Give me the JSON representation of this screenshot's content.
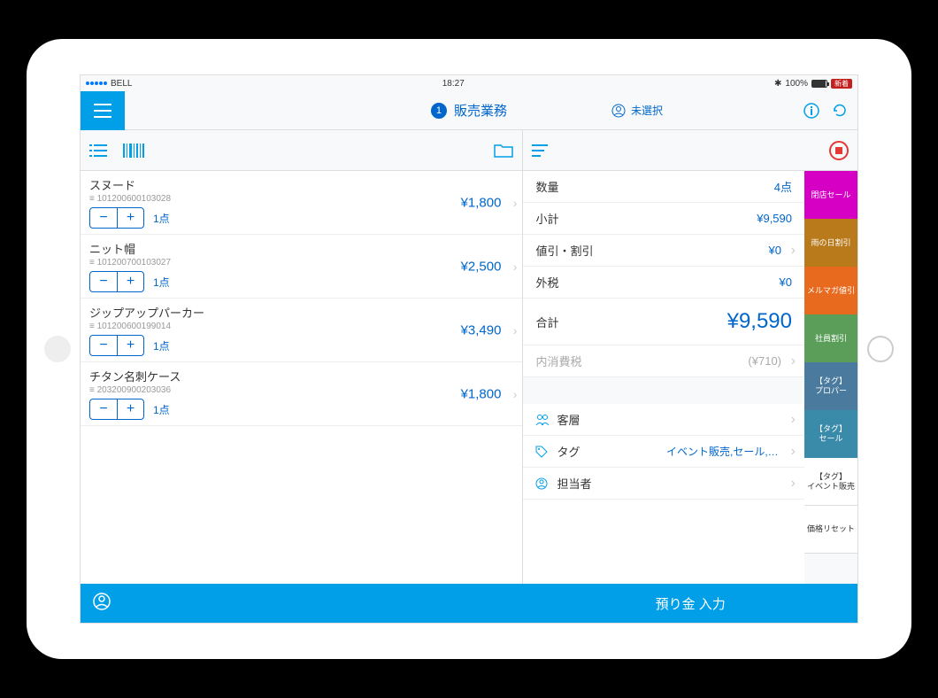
{
  "status": {
    "carrier": "BELL",
    "time": "18:27",
    "battery": "100%",
    "badge": "新着"
  },
  "header": {
    "badge": "1",
    "title": "販売業務",
    "user_status": "未選択"
  },
  "items": [
    {
      "name": "スヌード",
      "sku": "101200600103028",
      "qty": "1点",
      "price": "¥1,800"
    },
    {
      "name": "ニット帽",
      "sku": "101200700103027",
      "qty": "1点",
      "price": "¥2,500"
    },
    {
      "name": "ジップアップパーカー",
      "sku": "101200600199014",
      "qty": "1点",
      "price": "¥3,490"
    },
    {
      "name": "チタン名刺ケース",
      "sku": "203200900203036",
      "qty": "1点",
      "price": "¥1,800"
    }
  ],
  "summary": {
    "qty_label": "数量",
    "qty_value": "4点",
    "subtotal_label": "小計",
    "subtotal_value": "¥9,590",
    "discount_label": "値引・割引",
    "discount_value": "¥0",
    "extax_label": "外税",
    "extax_value": "¥0",
    "total_label": "合計",
    "total_value": "¥9,590",
    "intax_label": "内消費税",
    "intax_value": "(¥710)",
    "segment_label": "客層",
    "tag_label": "タグ",
    "tag_value": "イベント販売,セール,プロ...",
    "staff_label": "担当者"
  },
  "quick_tags": [
    {
      "label": "閉店セール",
      "color": "#d500c4"
    },
    {
      "label": "雨の日割引",
      "color": "#b87a1a"
    },
    {
      "label": "メルマガ値引",
      "color": "#e86a1e"
    },
    {
      "label": "社員割引",
      "color": "#5a9e5a"
    },
    {
      "label": "【タグ】\nプロパー",
      "color": "#4a7a9e"
    },
    {
      "label": "【タグ】\nセール",
      "color": "#3a8aaa"
    },
    {
      "label": "【タグ】\nイベント販売",
      "color": "#ffffff",
      "text": "dark"
    },
    {
      "label": "価格リセット",
      "color": "#ffffff",
      "text": "dark"
    }
  ],
  "footer": {
    "action": "預り金 入力"
  }
}
